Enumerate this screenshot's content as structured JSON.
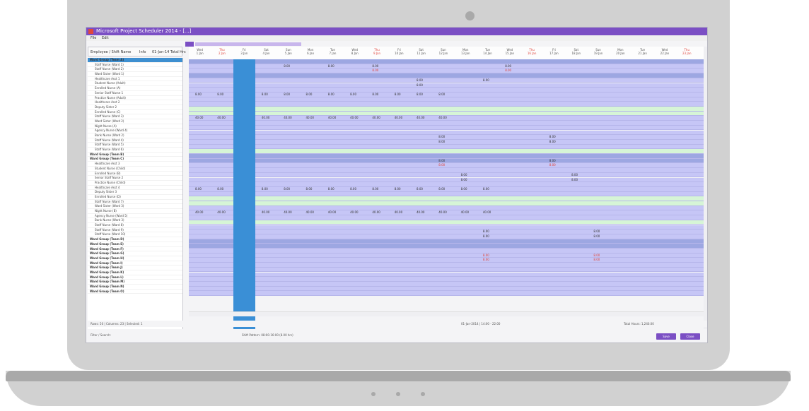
{
  "app": {
    "title": "Microsoft Project Scheduler 2014 - [...]",
    "menu": [
      "File",
      "Edit"
    ],
    "active_tab": "Calendar"
  },
  "left_panel": {
    "header": [
      "Employee / Shift Name",
      "Info",
      "01-Jan-14 Total Hrs"
    ],
    "rows": [
      "Ward Group (Team A)",
      "Staff Nurse (Ward 1)",
      "Staff Nurse (Ward 2)",
      "Ward Sister (Ward 1)",
      "Healthcare Asst 1",
      "Student Nurse (Adult)",
      "Enrolled Nurse (A)",
      "Senior Staff Nurse 1",
      "Practice Nurse (Adult)",
      "Healthcare Asst 2",
      "Deputy Sister 2",
      "Enrolled Nurse (C)",
      "Staff Nurse (Ward 3)",
      "Ward Sister (Ward 2)",
      "Night Nurse (A)",
      "Agency Nurse (Ward 4)",
      "Bank Nurse (Ward 2)",
      "Staff Nurse (Ward 4)",
      "Staff Nurse (Ward 5)",
      "Staff Nurse (Ward 6)",
      "Ward Group (Team B)",
      "Ward Group (Team C)",
      "Healthcare Asst 3",
      "Student Nurse (Child)",
      "Enrolled Nurse (B)",
      "Senior Staff Nurse 2",
      "Practice Nurse (Child)",
      "Healthcare Asst 4",
      "Deputy Sister 3",
      "Enrolled Nurse (D)",
      "Staff Nurse (Ward 7)",
      "Ward Sister (Ward 3)",
      "Night Nurse (B)",
      "Agency Nurse (Ward 5)",
      "Bank Nurse (Ward 3)",
      "Staff Nurse (Ward 8)",
      "Staff Nurse (Ward 9)",
      "Staff Nurse (Ward 10)",
      "Ward Group (Team D)",
      "Ward Group (Team E)",
      "Ward Group (Team F)",
      "Ward Group (Team G)",
      "Ward Group (Team H)",
      "Ward Group (Team I)",
      "Ward Group (Team J)",
      "Ward Group (Team K)",
      "Ward Group (Team L)",
      "Ward Group (Team M)",
      "Ward Group (Team N)",
      "Ward Group (Team O)"
    ]
  },
  "grid": {
    "columns": [
      {
        "day": "Wed",
        "date": "1 Jan"
      },
      {
        "day": "Thu",
        "date": "2 Jan"
      },
      {
        "day": "Fri",
        "date": "3 Jan"
      },
      {
        "day": "Sat",
        "date": "4 Jan"
      },
      {
        "day": "Sun",
        "date": "5 Jan"
      },
      {
        "day": "Mon",
        "date": "6 Jan"
      },
      {
        "day": "Tue",
        "date": "7 Jan"
      },
      {
        "day": "Wed",
        "date": "8 Jan"
      },
      {
        "day": "Thu",
        "date": "9 Jan"
      },
      {
        "day": "Fri",
        "date": "10 Jan"
      },
      {
        "day": "Sat",
        "date": "11 Jan"
      },
      {
        "day": "Sun",
        "date": "12 Jan"
      },
      {
        "day": "Mon",
        "date": "13 Jan"
      },
      {
        "day": "Tue",
        "date": "14 Jan"
      },
      {
        "day": "Wed",
        "date": "15 Jan"
      },
      {
        "day": "Thu",
        "date": "16 Jan"
      },
      {
        "day": "Fri",
        "date": "17 Jan"
      },
      {
        "day": "Sat",
        "date": "18 Jan"
      },
      {
        "day": "Sun",
        "date": "19 Jan"
      },
      {
        "day": "Mon",
        "date": "20 Jan"
      },
      {
        "day": "Tue",
        "date": "21 Jan"
      },
      {
        "day": "Wed",
        "date": "22 Jan"
      },
      {
        "day": "Thu",
        "date": "23 Jan"
      }
    ],
    "red_columns": [
      1,
      8,
      15,
      22
    ],
    "selected_column": 2,
    "cells": [
      {
        "row": 1,
        "col": 4,
        "text": "8.00"
      },
      {
        "row": 1,
        "col": 6,
        "text": "8.00"
      },
      {
        "row": 1,
        "col": 8,
        "text": "8.00"
      },
      {
        "row": 1,
        "col": 14,
        "text": "8.00"
      },
      {
        "row": 2,
        "col": 8,
        "text": "8.00",
        "red": true
      },
      {
        "row": 2,
        "col": 14,
        "text": "8.00",
        "red": true
      },
      {
        "row": 4,
        "col": 10,
        "text": "8.00"
      },
      {
        "row": 4,
        "col": 13,
        "text": "8.00"
      },
      {
        "row": 5,
        "col": 10,
        "text": "8.00"
      },
      {
        "row": 7,
        "col": 0,
        "text": "8.00"
      },
      {
        "row": 7,
        "col": 1,
        "text": "8.00"
      },
      {
        "row": 7,
        "col": 3,
        "text": "8.00"
      },
      {
        "row": 7,
        "col": 4,
        "text": "8.00"
      },
      {
        "row": 7,
        "col": 5,
        "text": "8.00"
      },
      {
        "row": 7,
        "col": 6,
        "text": "8.00"
      },
      {
        "row": 7,
        "col": 7,
        "text": "8.00"
      },
      {
        "row": 7,
        "col": 8,
        "text": "8.00"
      },
      {
        "row": 7,
        "col": 9,
        "text": "8.00"
      },
      {
        "row": 7,
        "col": 10,
        "text": "8.00"
      },
      {
        "row": 7,
        "col": 11,
        "text": "8.00"
      },
      {
        "row": 12,
        "col": 0,
        "text": "40.00"
      },
      {
        "row": 12,
        "col": 1,
        "text": "40.00"
      },
      {
        "row": 12,
        "col": 3,
        "text": "40.00"
      },
      {
        "row": 12,
        "col": 4,
        "text": "40.00"
      },
      {
        "row": 12,
        "col": 5,
        "text": "40.00"
      },
      {
        "row": 12,
        "col": 6,
        "text": "40.00"
      },
      {
        "row": 12,
        "col": 7,
        "text": "40.00"
      },
      {
        "row": 12,
        "col": 8,
        "text": "40.00"
      },
      {
        "row": 12,
        "col": 9,
        "text": "40.00"
      },
      {
        "row": 12,
        "col": 10,
        "text": "40.00"
      },
      {
        "row": 12,
        "col": 11,
        "text": "40.00"
      },
      {
        "row": 16,
        "col": 11,
        "text": "8.00"
      },
      {
        "row": 16,
        "col": 16,
        "text": "8.00"
      },
      {
        "row": 17,
        "col": 11,
        "text": "8.00"
      },
      {
        "row": 17,
        "col": 16,
        "text": "8.00"
      },
      {
        "row": 21,
        "col": 11,
        "text": "8.00"
      },
      {
        "row": 21,
        "col": 16,
        "text": "8.00"
      },
      {
        "row": 22,
        "col": 11,
        "text": "8.00",
        "red": true
      },
      {
        "row": 22,
        "col": 16,
        "text": "8.00",
        "red": true
      },
      {
        "row": 24,
        "col": 12,
        "text": "8.00"
      },
      {
        "row": 24,
        "col": 17,
        "text": "8.00"
      },
      {
        "row": 25,
        "col": 12,
        "text": "8.00"
      },
      {
        "row": 25,
        "col": 17,
        "text": "8.00"
      },
      {
        "row": 27,
        "col": 0,
        "text": "8.00"
      },
      {
        "row": 27,
        "col": 1,
        "text": "8.00"
      },
      {
        "row": 27,
        "col": 3,
        "text": "8.00"
      },
      {
        "row": 27,
        "col": 4,
        "text": "8.00"
      },
      {
        "row": 27,
        "col": 5,
        "text": "8.00"
      },
      {
        "row": 27,
        "col": 6,
        "text": "8.00"
      },
      {
        "row": 27,
        "col": 7,
        "text": "8.00"
      },
      {
        "row": 27,
        "col": 8,
        "text": "8.00"
      },
      {
        "row": 27,
        "col": 9,
        "text": "8.00"
      },
      {
        "row": 27,
        "col": 10,
        "text": "8.00"
      },
      {
        "row": 27,
        "col": 11,
        "text": "8.00"
      },
      {
        "row": 27,
        "col": 12,
        "text": "8.00"
      },
      {
        "row": 27,
        "col": 13,
        "text": "8.00"
      },
      {
        "row": 32,
        "col": 0,
        "text": "40.00"
      },
      {
        "row": 32,
        "col": 1,
        "text": "40.00"
      },
      {
        "row": 32,
        "col": 3,
        "text": "40.00"
      },
      {
        "row": 32,
        "col": 4,
        "text": "40.00"
      },
      {
        "row": 32,
        "col": 5,
        "text": "40.00"
      },
      {
        "row": 32,
        "col": 6,
        "text": "40.00"
      },
      {
        "row": 32,
        "col": 7,
        "text": "40.00"
      },
      {
        "row": 32,
        "col": 8,
        "text": "40.00"
      },
      {
        "row": 32,
        "col": 9,
        "text": "40.00"
      },
      {
        "row": 32,
        "col": 10,
        "text": "40.00"
      },
      {
        "row": 32,
        "col": 11,
        "text": "40.00"
      },
      {
        "row": 32,
        "col": 12,
        "text": "40.00"
      },
      {
        "row": 32,
        "col": 13,
        "text": "40.00"
      },
      {
        "row": 36,
        "col": 13,
        "text": "8.00"
      },
      {
        "row": 36,
        "col": 18,
        "text": "8.00"
      },
      {
        "row": 37,
        "col": 13,
        "text": "8.00"
      },
      {
        "row": 37,
        "col": 18,
        "text": "8.00"
      },
      {
        "row": 41,
        "col": 13,
        "text": "8.00",
        "red": true
      },
      {
        "row": 41,
        "col": 18,
        "text": "8.00",
        "red": true
      },
      {
        "row": 42,
        "col": 13,
        "text": "8.00",
        "red": true
      },
      {
        "row": 42,
        "col": 18,
        "text": "8.00",
        "red": true
      }
    ],
    "green_rows": [
      10,
      11,
      19,
      29,
      30,
      34
    ],
    "dark_rows": [
      0,
      3,
      20,
      21,
      38,
      39
    ]
  },
  "status": {
    "left": "Rows: 50 | Columns: 23 | Selected: 1",
    "mid": "01-Jan-2014 | 14:00 - 22:00",
    "right": "Total Hours: 1,240.00"
  },
  "bottom": {
    "label": "Filter / Search:",
    "info": "Shift Pattern: 08:00-16:00 (8.00 hrs)",
    "buttons": [
      "Save",
      "Close"
    ]
  },
  "colors": {
    "accent": "#7b4fc4",
    "grid_row": "#c6c6f6",
    "grid_green": "#d6f5d6",
    "selected_column": "#3a8fd6",
    "red_text": "#e0463d"
  }
}
